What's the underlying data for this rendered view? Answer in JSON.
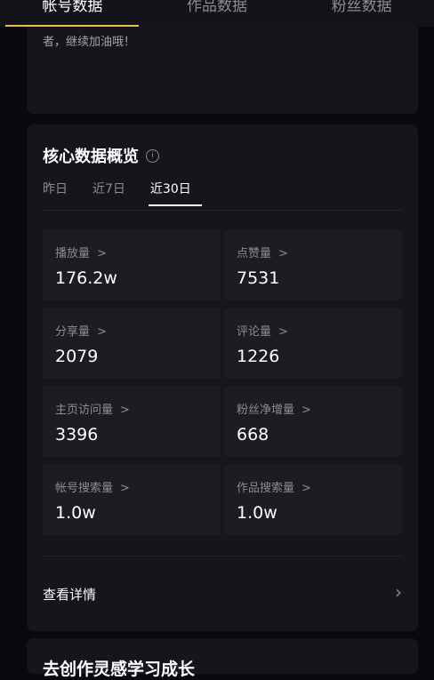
{
  "tabs": [
    {
      "label": "帐号数据",
      "active": true
    },
    {
      "label": "作品数据",
      "active": false
    },
    {
      "label": "粉丝数据",
      "active": false
    }
  ],
  "encourage_text": "者，继续加油哦！",
  "overview": {
    "title": "核心数据概览",
    "info_icon": "info-circle-icon",
    "ranges": [
      {
        "label": "昨日",
        "active": false
      },
      {
        "label": "近7日",
        "active": false
      },
      {
        "label": "近30日",
        "active": true
      }
    ],
    "metrics": [
      {
        "label": "播放量",
        "value": "176.2w"
      },
      {
        "label": "点赞量",
        "value": "7531"
      },
      {
        "label": "分享量",
        "value": "2079"
      },
      {
        "label": "评论量",
        "value": "1226"
      },
      {
        "label": "主页访问量",
        "value": "3396"
      },
      {
        "label": "粉丝净增量",
        "value": "668"
      },
      {
        "label": "帐号搜索量",
        "value": "1.0w"
      },
      {
        "label": "作品搜索量",
        "value": "1.0w"
      }
    ],
    "view_details": "查看详情"
  },
  "next_section_title": "去创作灵感学习成长",
  "colors": {
    "background": "#0a0a0e",
    "card": "#15151b",
    "metric_cell": "#1c1c23",
    "tab_indicator": "#e6c24b"
  }
}
